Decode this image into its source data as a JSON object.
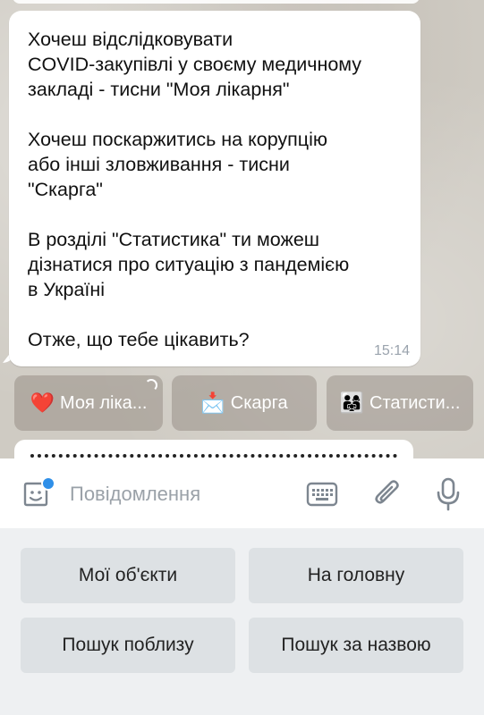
{
  "message": {
    "lines": [
      "Хочеш відслідковувати",
      "COVID-закупівлі у своєму медичному",
      "закладі - тисни \"Моя лікарня\"",
      "",
      "Хочеш поскаржитись на корупцію",
      "або інші зловживання - тисни",
      "\"Скарга\"",
      "",
      "В розділі \"Статистика\" ти можеш",
      "дізнатися про ситуацію з пандемією",
      "в Україні",
      "",
      "Отже, що тебе цікавить?"
    ],
    "time": "15:14"
  },
  "inline_buttons": [
    {
      "emoji": "❤️",
      "label": "Моя ліка..."
    },
    {
      "emoji": "📩",
      "label": "Скарга"
    },
    {
      "emoji": "👨‍👩‍👧",
      "label": "Статисти..."
    }
  ],
  "input": {
    "placeholder": "Повідомлення",
    "value": ""
  },
  "reply_keyboard": [
    {
      "label": "Мої об'єкти"
    },
    {
      "label": "На головну"
    },
    {
      "label": "Пошук поблизу"
    },
    {
      "label": "Пошук за назвою"
    }
  ],
  "colors": {
    "accent": "#2f8fe8",
    "icon": "#7d8690",
    "keyboard_bg": "#eef0f2",
    "keyboard_button": "#dde1e4"
  }
}
